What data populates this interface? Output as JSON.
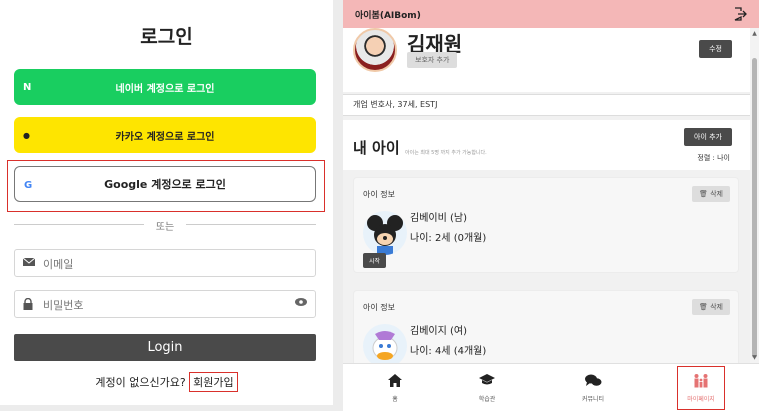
{
  "login": {
    "title": "로그인",
    "naver_label": "네이버 계정으로 로그인",
    "naver_icon": "N",
    "kakao_label": "카카오 계정으로 로그인",
    "kakao_icon": "●",
    "google_label": "Google 계정으로 로그인",
    "google_icon": "G",
    "divider_text": "또는",
    "email_placeholder": "이메일",
    "password_placeholder": "비밀번호",
    "login_button": "Login",
    "no_account_text": "계정이 없으신가요?",
    "signup_link": "회원가입"
  },
  "app": {
    "title": "아이봄(AIBom)",
    "profile": {
      "name": "김재원",
      "add_guardian": "보호자 추가",
      "edit": "수정",
      "details": "개업 변호사, 37세, ESTJ"
    },
    "kids_section": {
      "heading": "내 아이",
      "subtitle": "아이는 최대 5명 까지 추가 가능합니다.",
      "add_button": "아이 추가",
      "sort_label": "정렬 : 나이"
    },
    "kids": [
      {
        "card_title": "아이 정보",
        "delete": "🗑 삭제",
        "name": "김베이비 (남)",
        "age": "나이: 2세 (0개월)",
        "start": "시작"
      },
      {
        "card_title": "아이 정보",
        "delete": "🗑 삭제",
        "name": "김베이지 (여)",
        "age": "나이: 4세 (4개월)"
      }
    ],
    "nav": [
      {
        "label": "홈",
        "icon": "home-icon"
      },
      {
        "label": "학습관",
        "icon": "graduation-cap-icon"
      },
      {
        "label": "커뮤니티",
        "icon": "chat-icon"
      },
      {
        "label": "마이페이지",
        "icon": "family-icon"
      }
    ]
  },
  "colors": {
    "naver": "#19ce60",
    "kakao": "#fee500",
    "topbar": "#f4b7b7",
    "dark_button": "#4a4a4a",
    "highlight": "#d9302b"
  }
}
